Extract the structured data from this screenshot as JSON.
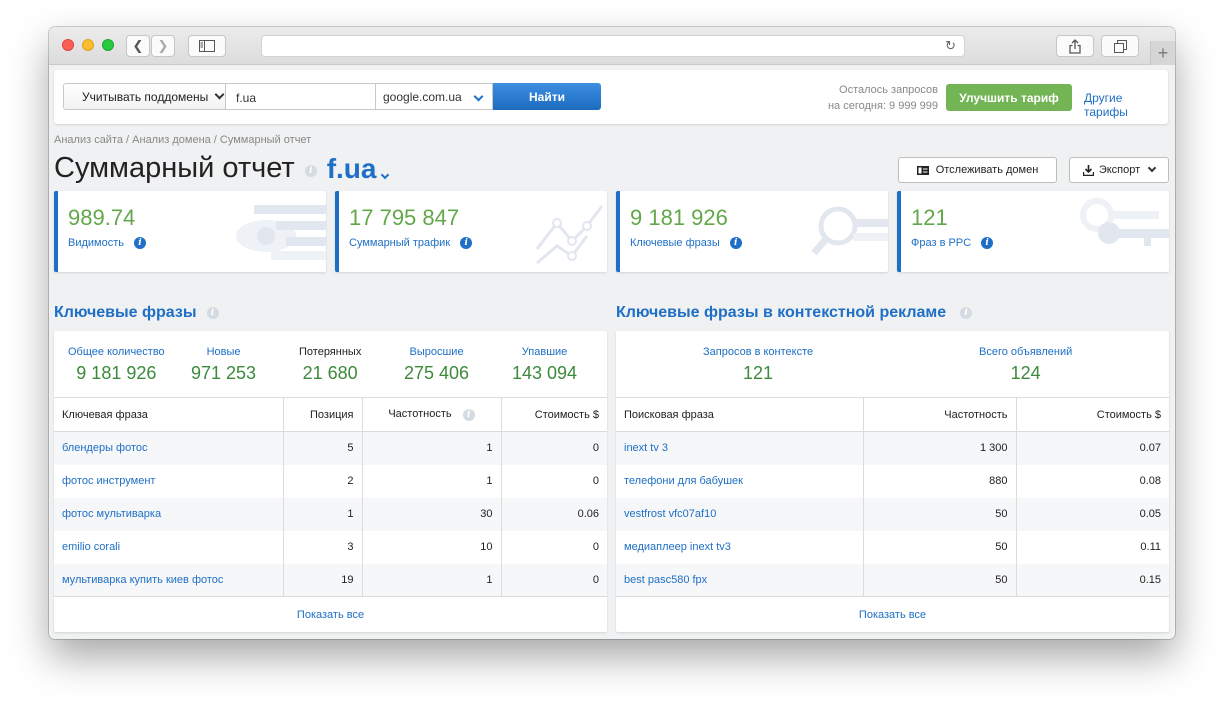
{
  "toolbar": {
    "subdomain_select": "Учитывать поддомены",
    "domain_value": "f.ua",
    "engine_select": "google.com.ua",
    "find_button": "Найти",
    "quota_line1": "Осталось запросов",
    "quota_line2": "на сегодня: 9 999 999",
    "upgrade_button": "Улучшить тариф",
    "other_tariffs": "Другие тарифы"
  },
  "breadcrumb": "Анализ сайта / Анализ домена / Суммарный отчет",
  "page": {
    "title": "Суммарный отчет",
    "domain": "f.ua",
    "track_button": "Отслеживать домен",
    "export_button": "Экспорт"
  },
  "cards": [
    {
      "value": "989.74",
      "label": "Видимость"
    },
    {
      "value": "17 795 847",
      "label": "Суммарный трафик"
    },
    {
      "value": "9 181 926",
      "label": "Ключевые фразы"
    },
    {
      "value": "121",
      "label": "Фраз в PPC"
    }
  ],
  "organic": {
    "title": "Ключевые фразы",
    "stats": [
      {
        "label": "Общее количество",
        "value": "9 181 926"
      },
      {
        "label": "Новые",
        "value": "971 253"
      },
      {
        "label": "Потерянных",
        "value": "21 680"
      },
      {
        "label": "Выросшие",
        "value": "275 406"
      },
      {
        "label": "Упавшие",
        "value": "143 094"
      }
    ],
    "columns": [
      "Ключевая фраза",
      "Позиция",
      "Частотность",
      "Стоимость $"
    ],
    "rows": [
      [
        "блендеры фотос",
        "5",
        "1",
        "0"
      ],
      [
        "фотос инструмент",
        "2",
        "1",
        "0"
      ],
      [
        "фотос мультиварка",
        "1",
        "30",
        "0.06"
      ],
      [
        "emilio corali",
        "3",
        "10",
        "0"
      ],
      [
        "мультиварка купить киев фотос",
        "19",
        "1",
        "0"
      ]
    ],
    "show_all": "Показать все"
  },
  "ppc": {
    "title": "Ключевые фразы в контекстной рекламе",
    "stats": [
      {
        "label": "Запросов в контексте",
        "value": "121"
      },
      {
        "label": "Всего объявлений",
        "value": "124"
      }
    ],
    "columns": [
      "Поисковая фраза",
      "Частотность",
      "Стоимость $"
    ],
    "rows": [
      [
        "inext tv 3",
        "1 300",
        "0.07"
      ],
      [
        "телефони для бабушек",
        "880",
        "0.08"
      ],
      [
        "vestfrost vfc07af10",
        "50",
        "0.05"
      ],
      [
        "медиаплеер inext tv3",
        "50",
        "0.11"
      ],
      [
        "best pasc580 fpx",
        "50",
        "0.15"
      ]
    ],
    "show_all": "Показать все"
  },
  "colors": {
    "accent": "#1e6fc5",
    "value_green": "#62a84a",
    "upgrade_green": "#73b554"
  }
}
